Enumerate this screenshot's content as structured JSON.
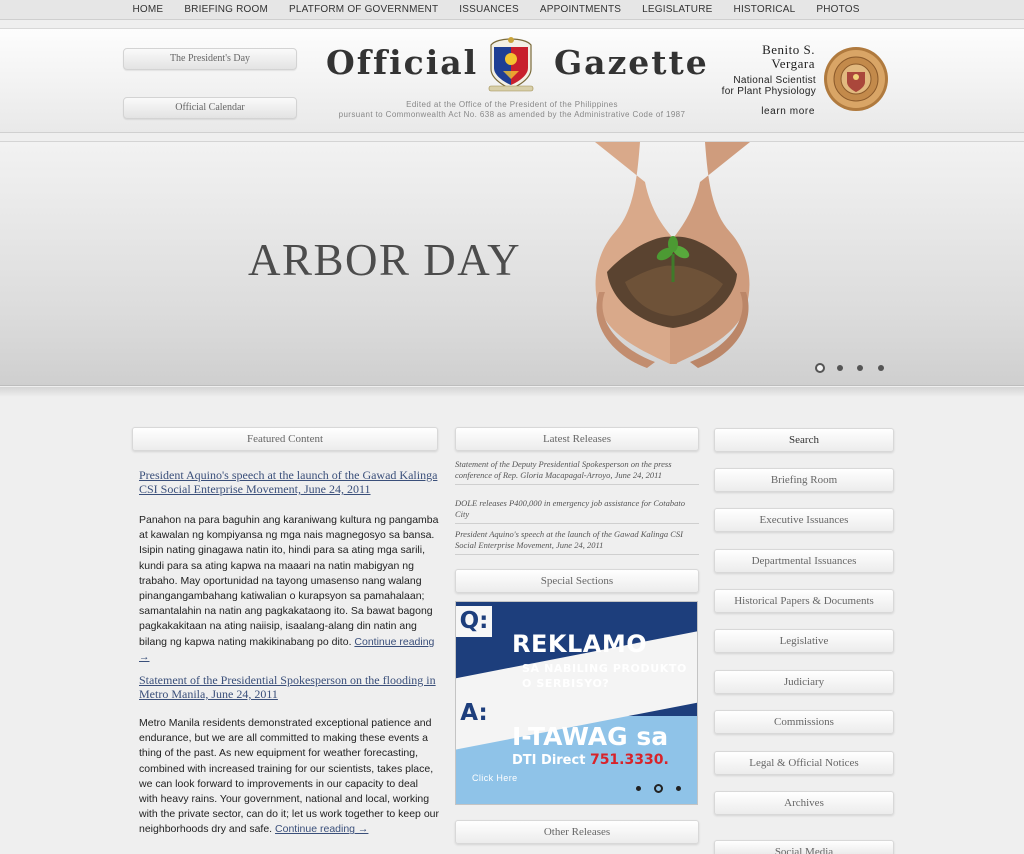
{
  "nav": {
    "items": [
      "HOME",
      "BRIEFING ROOM",
      "PLATFORM OF GOVERNMENT",
      "ISSUANCES",
      "APPOINTMENTS",
      "LEGISLATURE",
      "HISTORICAL",
      "PHOTOS"
    ]
  },
  "header": {
    "presidents_day": "The President's Day",
    "official_calendar": "Official Calendar",
    "title_left": "Official",
    "title_right": "Gazette",
    "edited_line1": "Edited at the Office of the President of the Philippines",
    "edited_line2": "pursuant to Commonwealth Act No. 638 as amended by the Administrative Code of 1987",
    "feature": {
      "name_line1": "Benito S.",
      "name_line2": "Vergara",
      "sub_line1": "National Scientist",
      "sub_line2": "for Plant Physiology",
      "learn_more": "learn more"
    }
  },
  "banner": {
    "title": "ARBOR DAY",
    "slides": 4,
    "active_slide": 1
  },
  "featured": {
    "heading": "Featured Content",
    "articles": [
      {
        "title": "President Aquino's speech at the launch of the Gawad Kalinga CSI Social Enterprise Movement, June 24, 2011",
        "body": "Panahon na para baguhin ang karaniwang kultura ng pangamba at kawalan ng kompiyansa ng mga nais magnegosyo sa bansa. Isipin nating ginagawa natin ito, hindi para sa ating mga sarili, kundi para sa ating kapwa na maaari na natin mabigyan ng trabaho. May oportunidad na tayong umasenso nang walang pinangangambahang katiwalian o kurapsyon sa pamahalaan; samantalahin na natin ang pagkakataong ito. Sa bawat bagong pagkakakitaan na ating naiisip, isaalang-alang din natin ang bilang ng kapwa nating makikinabang po dito.",
        "more": "Continue reading →"
      },
      {
        "title": "Statement of the Presidential Spokesperson on the flooding in Metro Manila, June 24, 2011",
        "body": "Metro Manila residents demonstrated exceptional patience and endurance, but we are all committed to making these events a thing of the past. As new equipment for weather forecasting, combined with increased training for our scientists, takes place, we can look forward to improvements in our capacity to deal with heavy rains. Your government, national and local, working with the private sector, can do it; let us work together to keep our neighborhoods dry and safe.",
        "more": "Continue reading →"
      }
    ]
  },
  "latest": {
    "heading": "Latest Releases",
    "items": [
      "Statement of the Deputy Presidential Spokesperson on the press conference of Rep. Gloria Macapagal-Arroyo, June 24, 2011",
      "DOLE releases P400,000 in emergency job assistance for Cotabato City",
      "President Aquino's speech at the launch of the Gawad Kalinga CSI Social Enterprise Movement, June 24, 2011"
    ]
  },
  "special": {
    "heading": "Special Sections",
    "ad": {
      "q": "Q:",
      "a": "A:",
      "headline": "REKLAMO",
      "sub_line1": "SA NABILING PRODUKTO",
      "sub_line2": "O SERBISYO?",
      "call": "I-TAWAG sa",
      "dti": "DTI Direct",
      "number": "751.3330.",
      "click_here": "Click Here",
      "slides": 3,
      "active_slide": 2
    }
  },
  "other": {
    "heading": "Other Releases"
  },
  "sidebar": {
    "items": [
      "Search",
      "Briefing Room",
      "Executive Issuances",
      "Departmental Issuances",
      "Historical Papers & Documents",
      "Legislative",
      "Judiciary",
      "Commissions",
      "Legal & Official Notices",
      "Archives",
      "Social Media"
    ]
  },
  "colors": {
    "link": "#3a4f7a",
    "ad_navy": "#1d3e7c",
    "ad_sky": "#8fc3e8",
    "ad_red": "#d8232a"
  }
}
